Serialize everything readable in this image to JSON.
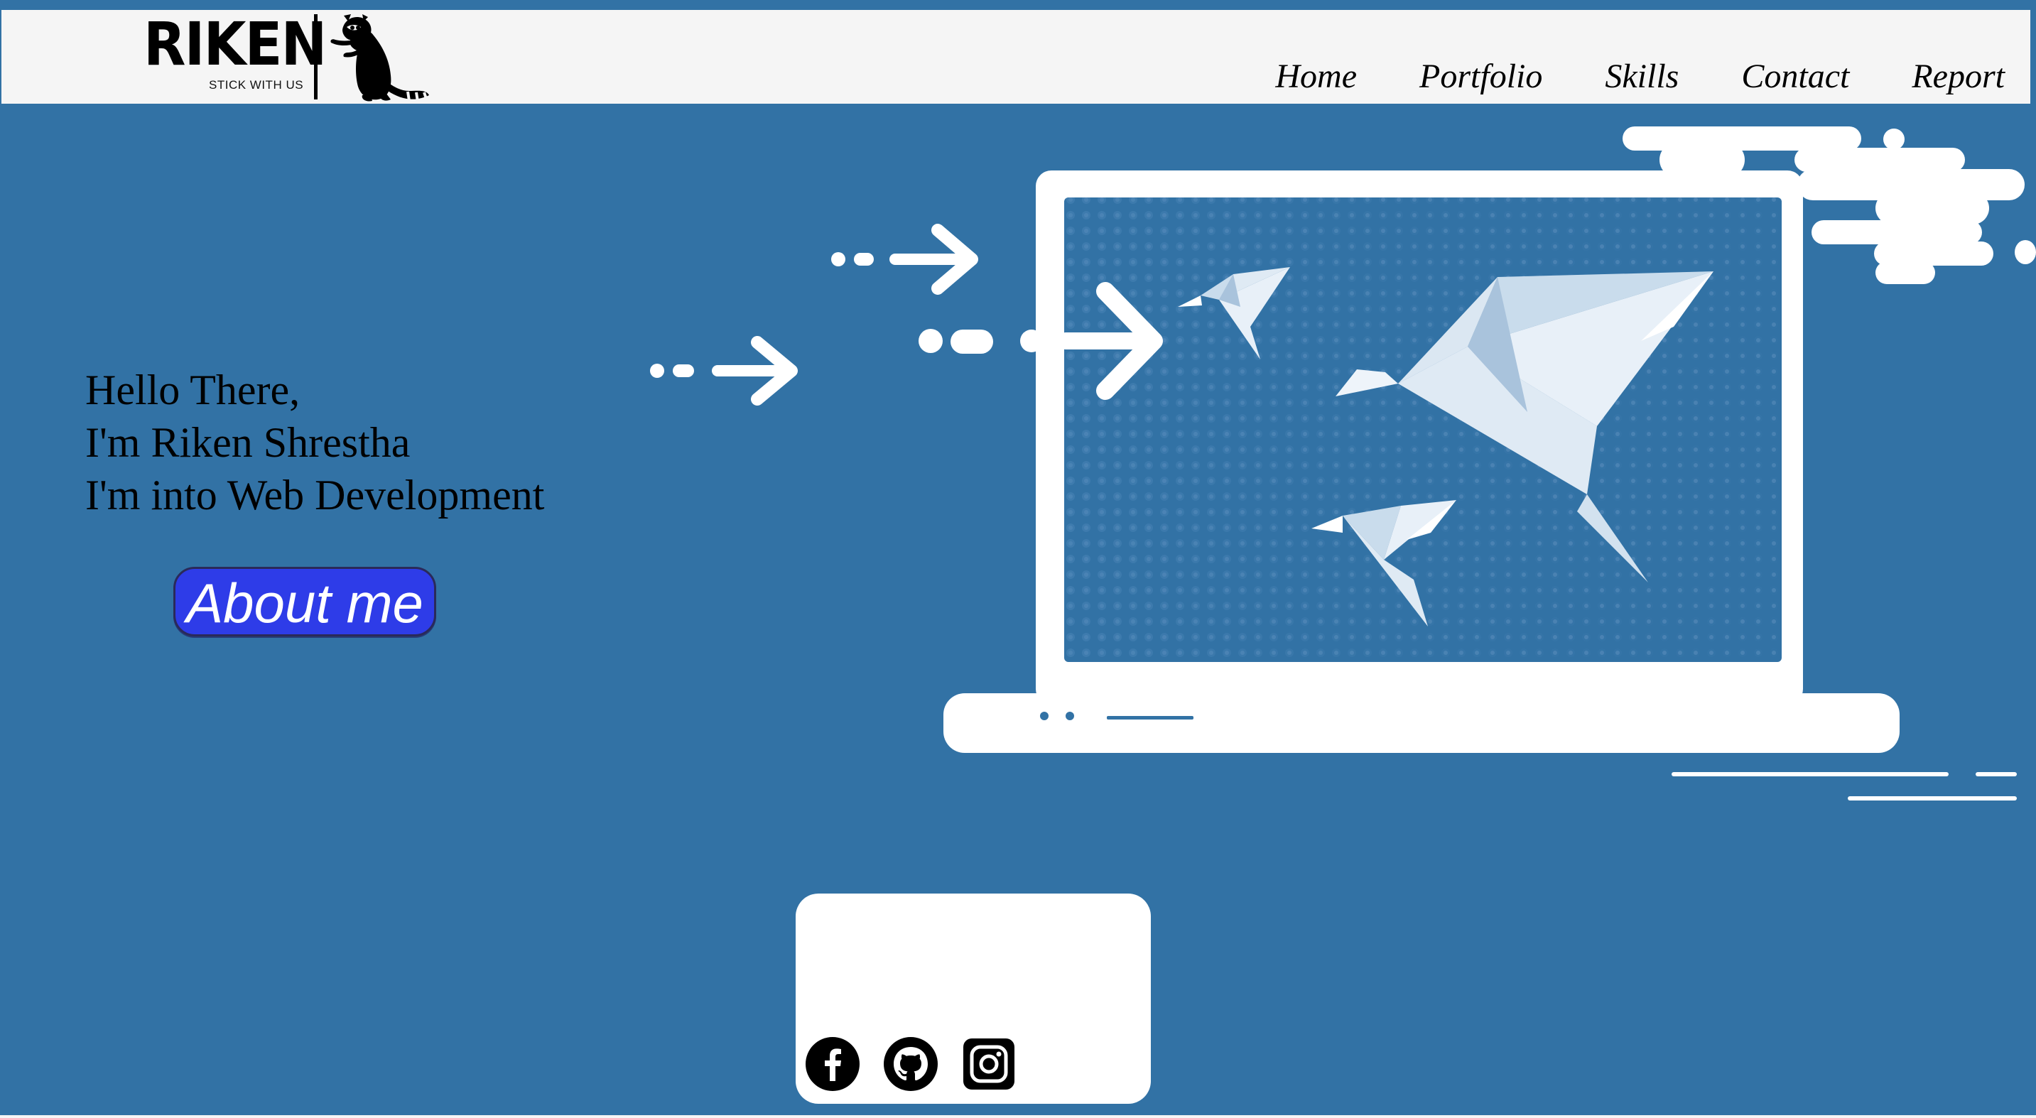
{
  "logo": {
    "name": "RIKEN",
    "tagline": "STICK WITH US"
  },
  "nav": {
    "items": [
      {
        "label": "Home"
      },
      {
        "label": "Portfolio"
      },
      {
        "label": "Skills"
      },
      {
        "label": "Contact"
      },
      {
        "label": "Report"
      }
    ]
  },
  "hero": {
    "line1": "Hello There,",
    "line2": "I'm Riken Shrestha",
    "line3": "I'm into Web Development",
    "cta_label": "About me"
  },
  "social": {
    "icons": [
      "facebook-icon",
      "github-icon",
      "instagram-icon"
    ]
  },
  "colors": {
    "background": "#3272a5",
    "header": "#f5f5f5",
    "button": "#2e3ce8"
  }
}
